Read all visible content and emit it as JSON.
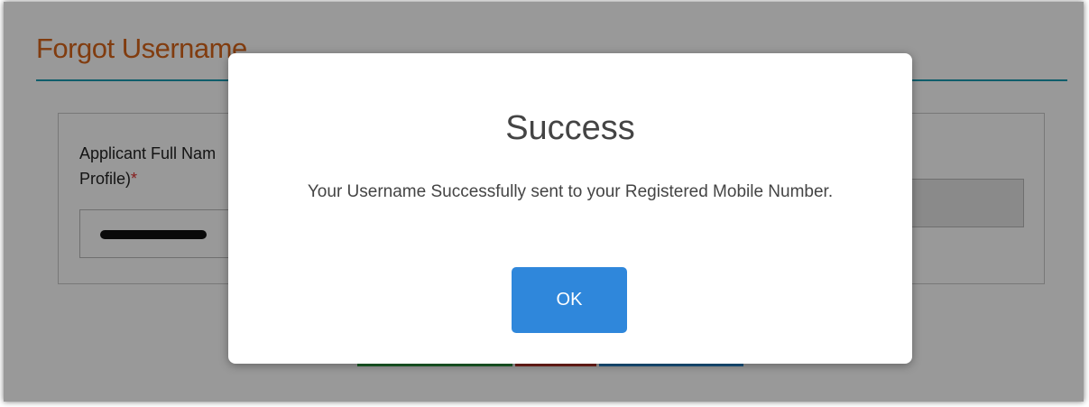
{
  "page": {
    "title": "Forgot Username",
    "form": {
      "applicant_label": "Applicant Full Nam\nProfile)",
      "required_marker": "*"
    }
  },
  "modal": {
    "title": "Success",
    "message": "Your Username Successfully sent to your Registered Mobile Number.",
    "ok_label": "OK"
  },
  "colors": {
    "title_orange": "#d8651a",
    "rule_teal": "#1a9bb3",
    "ok_blue": "#2f87db",
    "strip_green": "#2e9e44",
    "strip_red": "#c0352b",
    "strip_blue": "#2b8ad6"
  }
}
